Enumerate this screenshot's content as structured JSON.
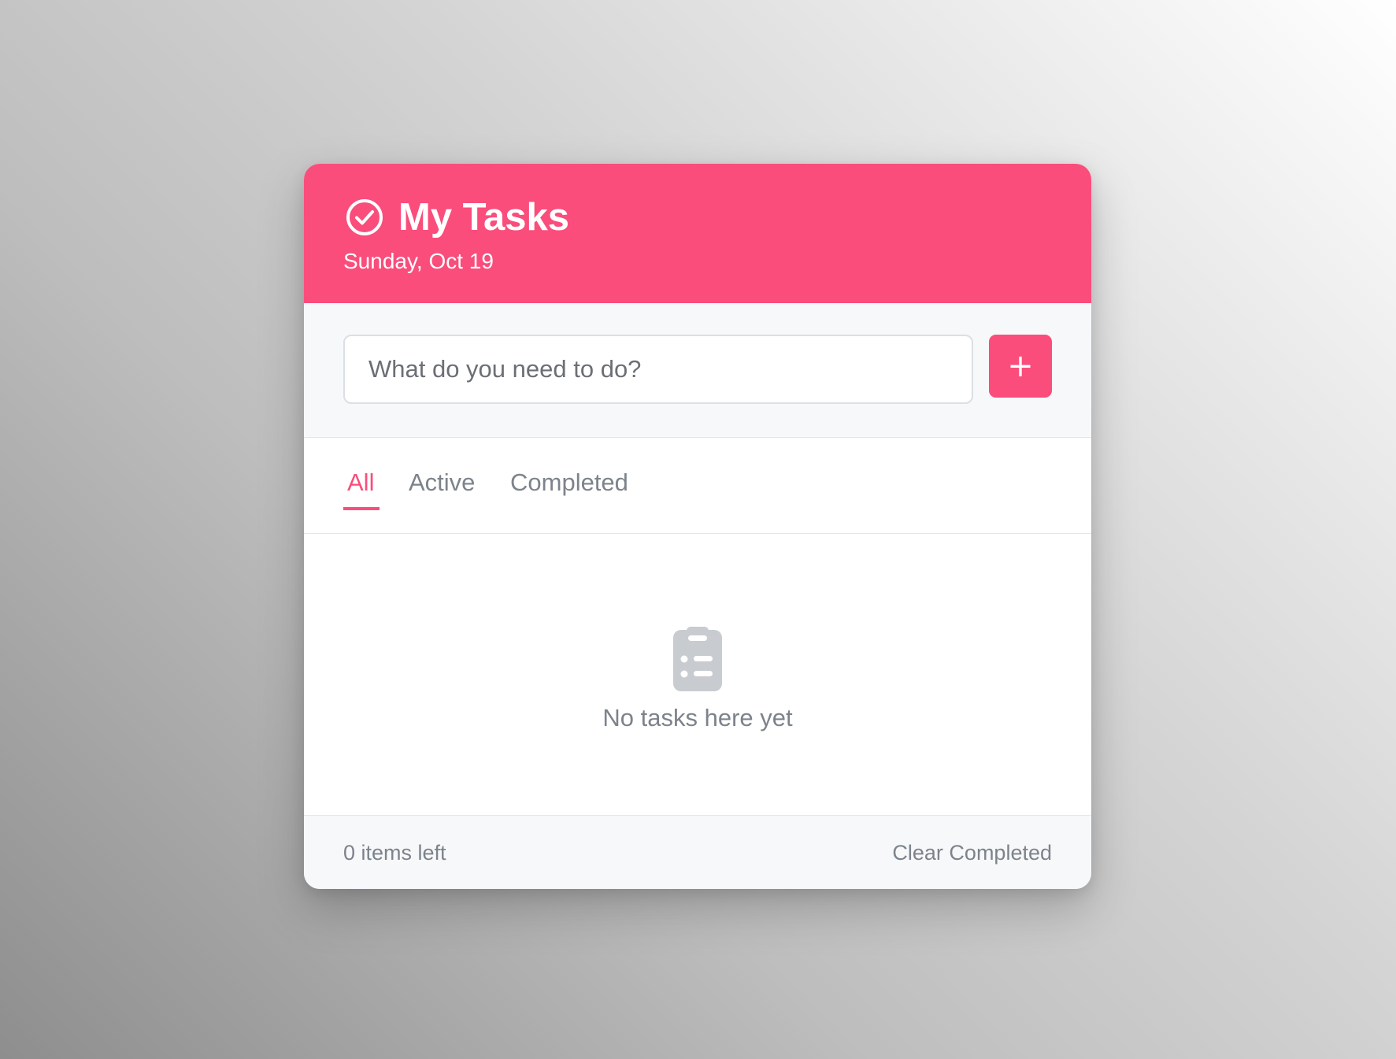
{
  "header": {
    "title": "My Tasks",
    "date": "Sunday, Oct 19",
    "icon": "check-circle-icon"
  },
  "input": {
    "value": "",
    "placeholder": "What do you need to do?",
    "add_label": "+"
  },
  "tabs": [
    {
      "label": "All",
      "active": true
    },
    {
      "label": "Active",
      "active": false
    },
    {
      "label": "Completed",
      "active": false
    }
  ],
  "empty_state": {
    "icon": "clipboard-list-icon",
    "message": "No tasks here yet"
  },
  "footer": {
    "items_left": "0 items left",
    "clear_label": "Clear Completed"
  },
  "colors": {
    "accent": "#fa4d7b",
    "muted_text": "#7d838b",
    "panel_bg": "#f7f8fa",
    "empty_icon": "#c8cbd0"
  }
}
